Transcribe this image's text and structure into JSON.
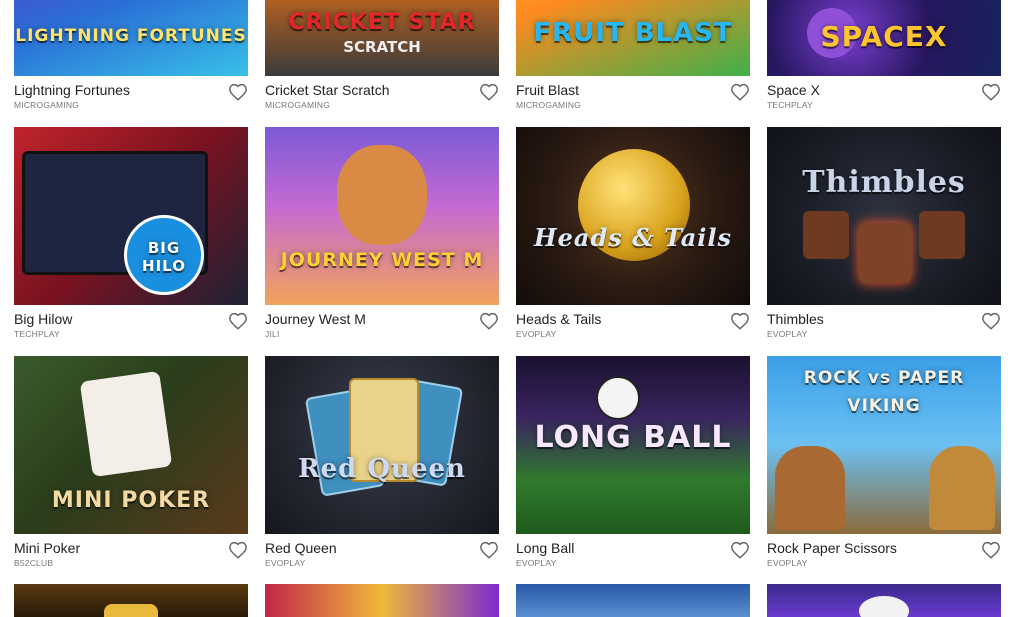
{
  "games": [
    {
      "title": "Lightning Fortunes",
      "provider": "MICROGAMING",
      "art": "LIGHTNING FORTUNES"
    },
    {
      "title": "Cricket Star Scratch",
      "provider": "MICROGAMING",
      "art": "CRICKET STAR"
    },
    {
      "title": "Fruit Blast",
      "provider": "MICROGAMING",
      "art": "FRUIT BLAST"
    },
    {
      "title": "Space X",
      "provider": "TECHPLAY",
      "art": "SPACEX"
    },
    {
      "title": "Big Hilow",
      "provider": "TECHPLAY",
      "art": "BIG HILO"
    },
    {
      "title": "Journey West M",
      "provider": "JILI",
      "art": "JOURNEY WEST M"
    },
    {
      "title": "Heads & Tails",
      "provider": "EVOPLAY",
      "art": "Heads & Tails"
    },
    {
      "title": "Thimbles",
      "provider": "EVOPLAY",
      "art": "Thimbles"
    },
    {
      "title": "Mini Poker",
      "provider": "B52CLUB",
      "art": "MINI POKER"
    },
    {
      "title": "Red Queen",
      "provider": "EVOPLAY",
      "art": "Red Queen"
    },
    {
      "title": "Long Ball",
      "provider": "EVOPLAY",
      "art": "LONG BALL"
    },
    {
      "title": "Rock Paper Scissors",
      "provider": "EVOPLAY",
      "art": "ROCK vs PAPER VIKING"
    }
  ],
  "colors": {
    "heart_stroke": "#666666",
    "title_text": "#222222",
    "provider_text": "#777777"
  },
  "icons": {
    "favorite": "heart-outline-icon"
  }
}
